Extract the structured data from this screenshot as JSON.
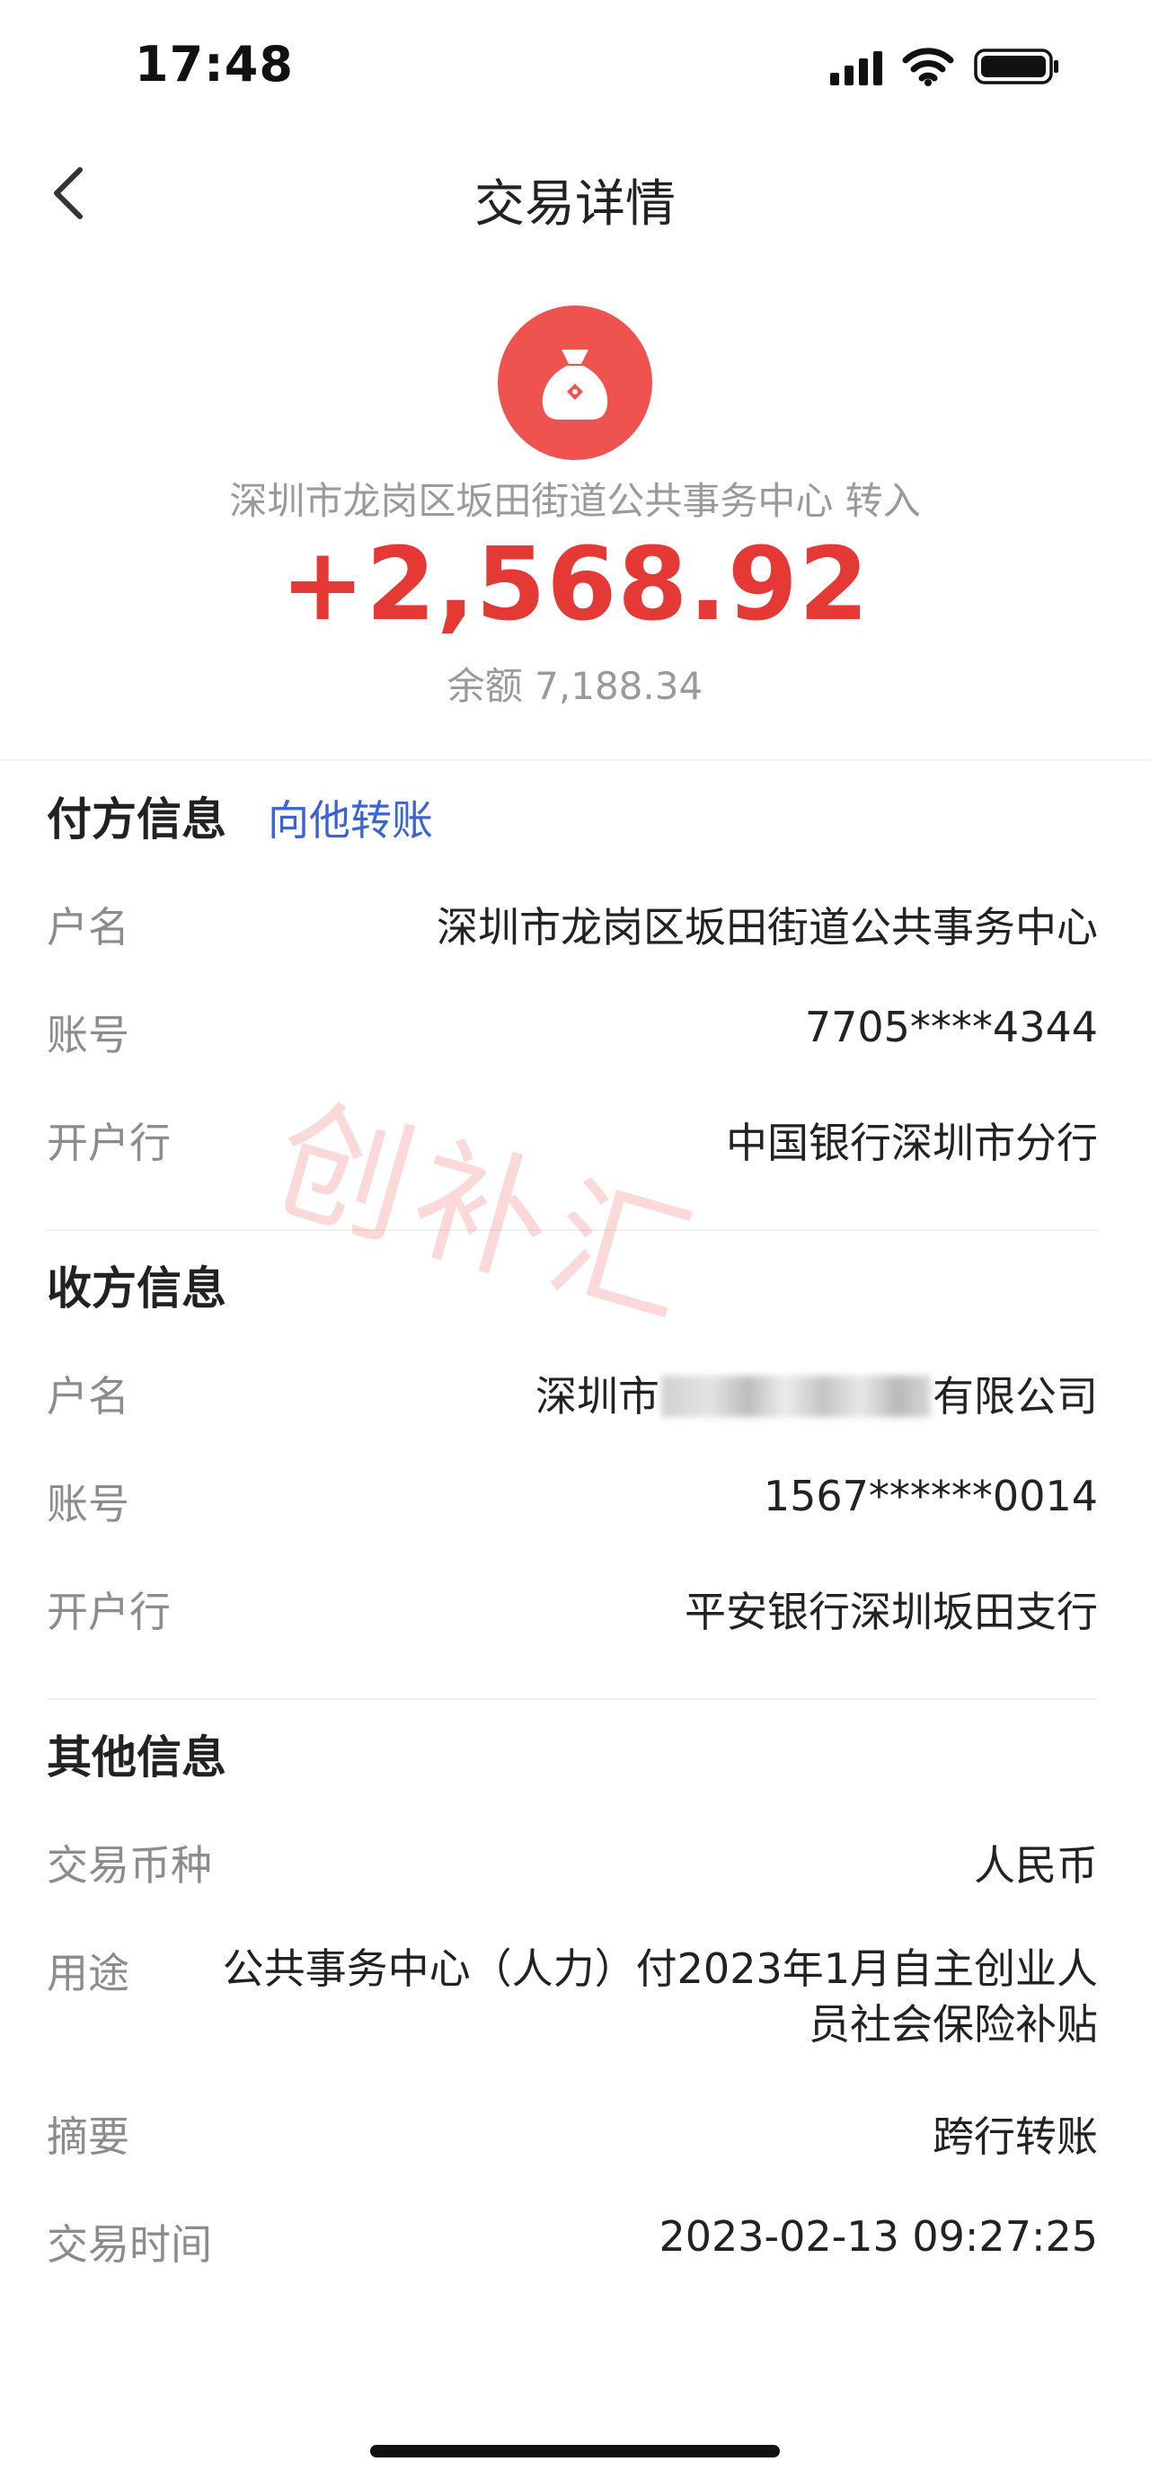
{
  "status_bar": {
    "time": "17:48"
  },
  "nav": {
    "title": "交易详情"
  },
  "transaction": {
    "counterparty_line": "深圳市龙岗区坂田街道公共事务中心  转入",
    "amount": "+2,568.92",
    "balance": "余额 7,188.34"
  },
  "payer": {
    "title": "付方信息",
    "action": "向他转账",
    "rows": [
      {
        "label": "户名",
        "value": "深圳市龙岗区坂田街道公共事务中心"
      },
      {
        "label": "账号",
        "value": "7705****4344"
      },
      {
        "label": "开户行",
        "value": "中国银行深圳市分行"
      }
    ]
  },
  "payee": {
    "title": "收方信息",
    "rows": [
      {
        "label": "户名",
        "value_prefix": "深圳市",
        "value_suffix": "有限公司"
      },
      {
        "label": "账号",
        "value": "1567******0014"
      },
      {
        "label": "开户行",
        "value": "平安银行深圳坂田支行"
      }
    ]
  },
  "other": {
    "title": "其他信息",
    "rows": [
      {
        "label": "交易币种",
        "value": "人民币"
      },
      {
        "label": "用途",
        "value": "公共事务中心（人力）付2023年1月自主创业人员社会保险补贴"
      },
      {
        "label": "摘要",
        "value": "跨行转账"
      },
      {
        "label": "交易时间",
        "value": "2023-02-13 09:27:25"
      }
    ]
  },
  "watermark": "创补汇",
  "colors": {
    "accent_red": "#e53935",
    "icon_bg": "#ef5350",
    "link_blue": "#3a63d6",
    "label_gray": "#8c8c8c"
  }
}
